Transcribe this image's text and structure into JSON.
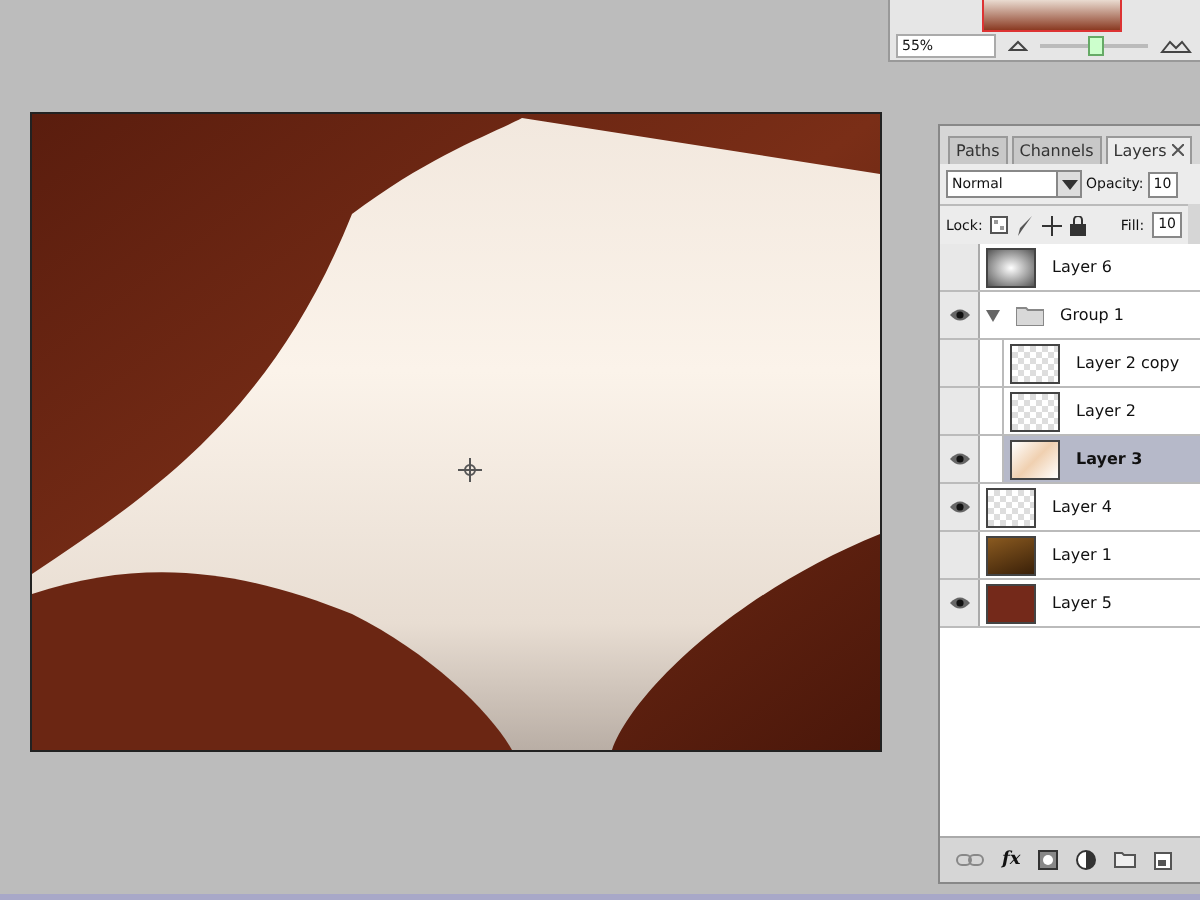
{
  "navigator": {
    "zoom": "55%",
    "zoom_slider": {
      "level": 0.5
    }
  },
  "layers_panel": {
    "tabs": [
      {
        "label": "Paths",
        "selected": false
      },
      {
        "label": "Channels",
        "selected": false
      },
      {
        "label": "Layers",
        "selected": true
      }
    ],
    "blend_mode": "Normal",
    "opacity_label": "Opacity:",
    "opacity": "10",
    "lock_label": "Lock:",
    "fill_label": "Fill:",
    "fill": "10",
    "style_button": "fx",
    "layers": [
      {
        "name": "Layer 6",
        "kind": "vignette",
        "visible": false,
        "selected": false
      },
      {
        "name": "Group 1",
        "kind": "group",
        "visible": true,
        "selected": false,
        "expanded": true,
        "children": [
          {
            "name": "Layer 2 copy",
            "kind": "transparent",
            "visible": false,
            "selected": false
          },
          {
            "name": "Layer 2",
            "kind": "transparent",
            "visible": false,
            "selected": false
          },
          {
            "name": "Layer 3",
            "kind": "paper",
            "visible": true,
            "selected": true
          }
        ]
      },
      {
        "name": "Layer 4",
        "kind": "transparent",
        "visible": true,
        "selected": false
      },
      {
        "name": "Layer 1",
        "kind": "wood",
        "visible": false,
        "selected": false
      },
      {
        "name": "Layer 5",
        "kind": "redwood",
        "visible": true,
        "selected": false
      }
    ]
  }
}
